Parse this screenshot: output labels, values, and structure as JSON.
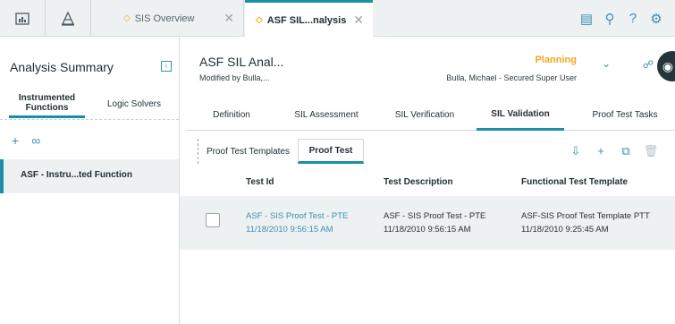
{
  "topbar": {
    "tabs": [
      {
        "label": "SIS Overview"
      },
      {
        "label": "ASF SIL...nalysis"
      }
    ]
  },
  "left": {
    "title": "Analysis Summary",
    "tabs": [
      "Instrumented Functions",
      "Logic Solvers"
    ],
    "item": "ASF - Instru...ted Function"
  },
  "asset": {
    "title": "ASF SIL Anal...",
    "modified": "Modified by Bulla,...",
    "state": "Planning",
    "user": "Bulla, Michael - Secured Super User"
  },
  "subtabs": [
    "Definition",
    "SIL Assessment",
    "SIL Verification",
    "SIL Validation",
    "Proof Test Tasks"
  ],
  "inner_tabs": [
    "Proof Test Templates",
    "Proof Test"
  ],
  "grid": {
    "headers": [
      "Test Id",
      "Test Description",
      "Functional Test Template"
    ],
    "rows": [
      {
        "test_id_1": "ASF - SIS Proof Test - PTE",
        "test_id_2": "11/18/2010 9:56:15 AM",
        "desc_1": "ASF - SIS Proof Test - PTE",
        "desc_2": "11/18/2010 9:56:15 AM",
        "tmpl_1": "ASF-SIS Proof Test Template PTT",
        "tmpl_2": "11/18/2010 9:25:45 AM"
      }
    ]
  },
  "colors": {
    "accent": "#1a8fa6",
    "link": "#3a8fb4",
    "state": "#f5a623"
  }
}
